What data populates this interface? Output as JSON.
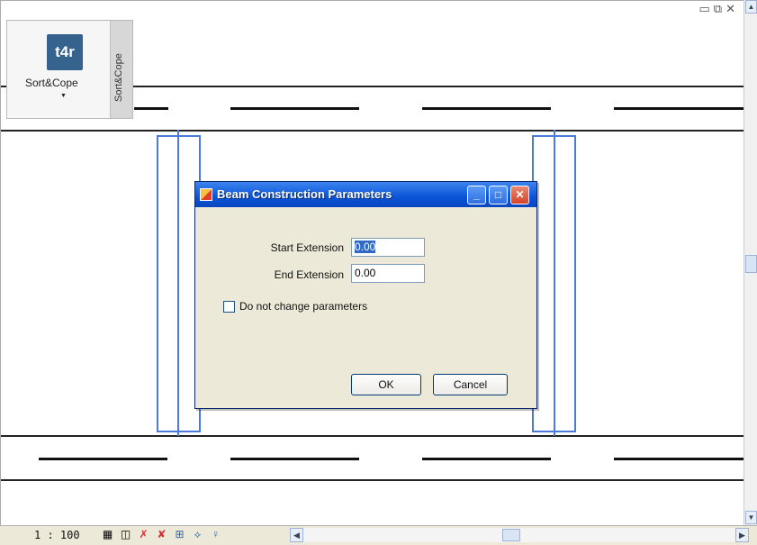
{
  "ribbon": {
    "logo_text": "t4r",
    "button_label": "Sort&Cope",
    "panel_tab_label": "Sort&Cope"
  },
  "window_controls": {
    "minimize": "▭",
    "restore": "⧉",
    "close": "✕"
  },
  "status": {
    "scale": "1 : 100"
  },
  "dialog": {
    "title": "Beam Construction Parameters",
    "start_extension_label": "Start Extension",
    "start_extension_value": "0.00",
    "end_extension_label": "End Extension",
    "end_extension_value": "0.00",
    "checkbox_label": "Do not change parameters",
    "checkbox_checked": false,
    "ok_label": "OK",
    "cancel_label": "Cancel"
  },
  "colors": {
    "titlebar": "#0a54d6",
    "columns": "#4a7bdc",
    "dialog_bg": "#ece9d8"
  }
}
